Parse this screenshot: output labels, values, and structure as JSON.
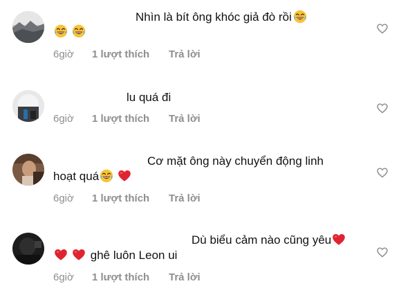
{
  "comments": [
    {
      "line1": "Nhìn là bít ông khóc giả đò rồi",
      "line1_emoji": [
        "laughing-tears-emoji"
      ],
      "line2": "",
      "line2_emoji": [
        "laughing-tears-emoji",
        "laughing-tears-emoji"
      ],
      "time": "6giờ",
      "likes": "1 lượt thích",
      "reply": "Trả lời"
    },
    {
      "line1": "lu quá đi",
      "line1_emoji": [],
      "line2": "",
      "line2_emoji": [],
      "time": "6giờ",
      "likes": "1 lượt thích",
      "reply": "Trả lời"
    },
    {
      "line1": "Cơ mặt ông này chuyển động linh",
      "line1_emoji": [],
      "line2": "hoạt quá",
      "line2_emoji": [
        "laughing-tears-emoji",
        "red-heart-emoji"
      ],
      "time": "6giờ",
      "likes": "1 lượt thích",
      "reply": "Trả lời"
    },
    {
      "line1": "Dù biểu cảm nào cũng yêu",
      "line1_emoji": [
        "red-heart-emoji"
      ],
      "line2": "ghê luôn Leon ui",
      "line2_emoji": [
        "red-heart-emoji",
        "red-heart-emoji"
      ],
      "time": "6giờ",
      "likes": "1 lượt thích",
      "reply": "Trả lời"
    }
  ],
  "colors": {
    "meta_text": "#8e8e8e",
    "heart_emoji": "#e0242f",
    "laugh_emoji": "#f8c33a"
  },
  "icons": {
    "like": "heart-outline-icon"
  }
}
